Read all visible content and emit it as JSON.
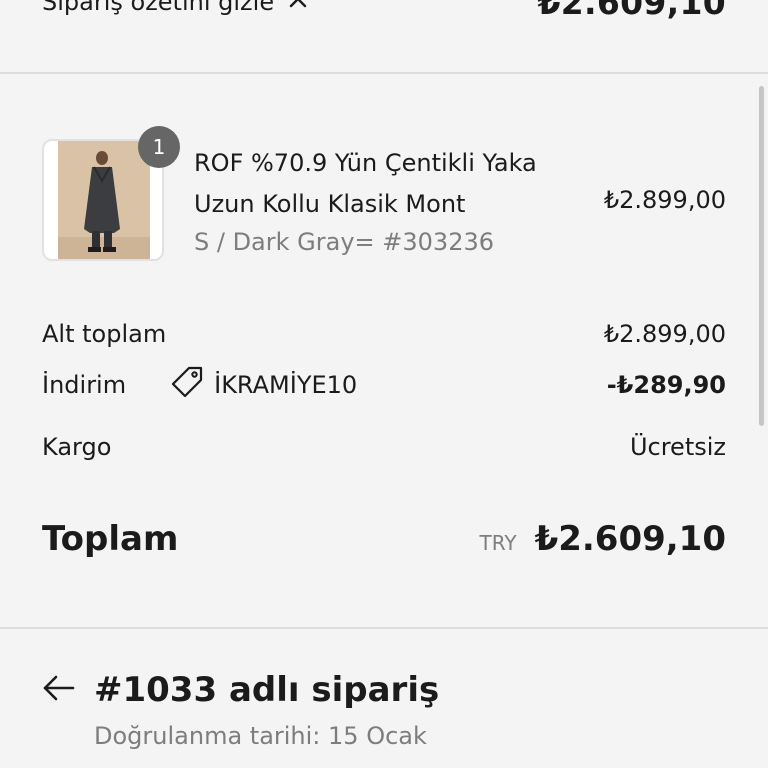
{
  "summary": {
    "toggle_label": "Sipariş özetini gizle",
    "total": "₺2.609,10"
  },
  "product": {
    "quantity": "1",
    "name": "ROF %70.9 Yün Çentikli Yaka Uzun Kollu Klasik Mont",
    "variant": "S / Dark Gray= #303236",
    "price": "₺2.899,00"
  },
  "totals": {
    "subtotal_label": "Alt toplam",
    "subtotal_value": "₺2.899,00",
    "discount_label": "İndirim",
    "discount_code": "İKRAMİYE10",
    "discount_value": "-₺289,90",
    "shipping_label": "Kargo",
    "shipping_value": "Ücretsiz",
    "total_label": "Toplam",
    "currency": "TRY",
    "total_value": "₺2.609,10"
  },
  "order": {
    "title": "#1033 adlı sipariş",
    "confirmed": "Doğrulanma tarihi: 15 Ocak"
  },
  "icons": {
    "toggle": "chevron-up-icon",
    "discount": "tag-icon",
    "back": "arrow-left-icon"
  }
}
